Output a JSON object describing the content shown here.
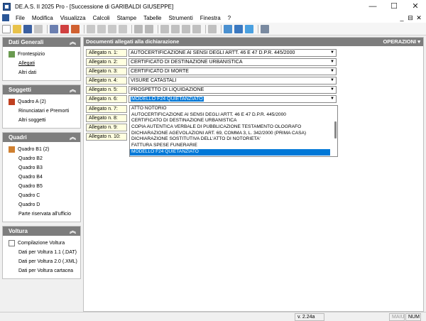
{
  "window": {
    "title": "DE.A.S. II 2025 Pro - [Successione di GARIBALDI GIUSEPPE]",
    "minimize": "—",
    "maximize": "☐",
    "close": "✕"
  },
  "menu": [
    "File",
    "Modifica",
    "Visualizza",
    "Calcoli",
    "Stampe",
    "Tabelle",
    "Strumenti",
    "Finestra",
    "?"
  ],
  "mdi_controls": [
    "_",
    "⊟",
    "✕"
  ],
  "sidebar": {
    "dati_generali": {
      "title": "Dati Generali",
      "items": [
        "Frontespizio",
        "Allegati",
        "Altri dati"
      ]
    },
    "soggetti": {
      "title": "Soggetti",
      "items": [
        "Quadro A (2)",
        "Rinunciatari e Premorti",
        "Altri soggetti"
      ]
    },
    "quadri": {
      "title": "Quadri",
      "items": [
        "Quadro B1 (2)",
        "Quadro B2",
        "Quadro B3",
        "Quadro B4",
        "Quadro B5",
        "Quadro C",
        "Quadro D",
        "Parte riservata all'ufficio"
      ]
    },
    "voltura": {
      "title": "Voltura",
      "items": [
        "Compilazione Voltura",
        "Dati per Voltura 1.1 (.DAT)",
        "Dati per Voltura 2.0 (.XML)",
        "Dati per Voltura cartacea"
      ]
    }
  },
  "main": {
    "header": "Documenti allegati alla dichiarazione",
    "operations": "OPERAZIONI",
    "allegati": [
      {
        "label": "Allegato n. 1:",
        "value": "AUTOCERTIFICAZIONE AI SENSI DEGLI ARTT. 46 E 47 D.P.R. 445/2000"
      },
      {
        "label": "Allegato n. 2:",
        "value": "CERTIFICATO DI DESTINAZIONE URBANISTICA"
      },
      {
        "label": "Allegato n. 3:",
        "value": "CERTIFICATO DI MORTE"
      },
      {
        "label": "Allegato n. 4:",
        "value": "VISURE CATASTALI"
      },
      {
        "label": "Allegato n. 5:",
        "value": "PROSPETTO DI LIQUIDAZIONE"
      },
      {
        "label": "Allegato n. 6:",
        "value": "MODELLO F24 QUIETANZIATO"
      },
      {
        "label": "Allegato n. 7:",
        "value": ""
      },
      {
        "label": "Allegato n. 8:",
        "value": ""
      },
      {
        "label": "Allegato n. 9:",
        "value": ""
      },
      {
        "label": "Allegato n. 10:",
        "value": ""
      }
    ],
    "dropdown_options": [
      "ATTO NOTORIO",
      "AUTOCERTIFICAZIONE AI SENSI DEGLI ARTT. 46 E 47 D.P.R. 445/2000",
      "CERTIFICATO DI DESTINAZIONE URBANISTICA",
      "COPIA AUTENTICA VERBALE DI PUBBLICAZIONE TESTAMENTO OLOGRAFO",
      "DICHIARAZIONE AGEVOLAZIONI ART. 69, COMMA 3, L. 342/2000 (PRIMA CASA)",
      "DICHIARAZIONE SOSTITUTIVA DELL'ATTO DI NOTORIETA'",
      "FATTURA SPESE FUNERARIE",
      "MODELLO F24 QUIETANZIATO"
    ],
    "dropdown_selected": "MODELLO F24 QUIETANZIATO"
  },
  "status": {
    "version": "v. 2.24a",
    "maiu": "MAIU",
    "num": "NUM"
  }
}
